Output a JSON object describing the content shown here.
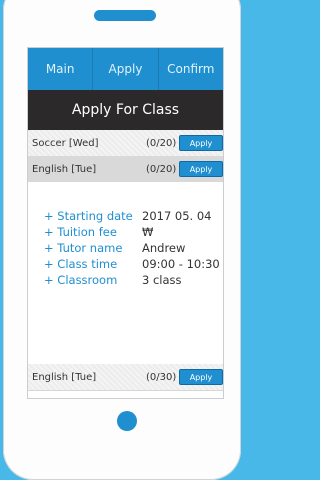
{
  "tabs": [
    "Main",
    "Apply",
    "Confirm"
  ],
  "title": "Apply For Class",
  "classes": [
    {
      "name": "Soccer [Wed]",
      "count": "(0/20)",
      "button": "Apply"
    },
    {
      "name": "English [Tue]",
      "count": "(0/20)",
      "button": "Apply"
    },
    {
      "name": "English [Tue]",
      "count": "(0/30)",
      "button": "Apply"
    }
  ],
  "details": [
    {
      "label": "+ Starting date",
      "value": "2017 05. 04"
    },
    {
      "label": "+ Tuition fee",
      "value": "₩"
    },
    {
      "label": "+ Tutor name",
      "value": "Andrew"
    },
    {
      "label": "+ Class time",
      "value": "09:00 - 10:30"
    },
    {
      "label": "+ Classroom",
      "value": "3 class"
    }
  ],
  "colors": {
    "accent": "#1f8fd0",
    "background": "#47b8e8",
    "title_bar": "#2b2929"
  }
}
